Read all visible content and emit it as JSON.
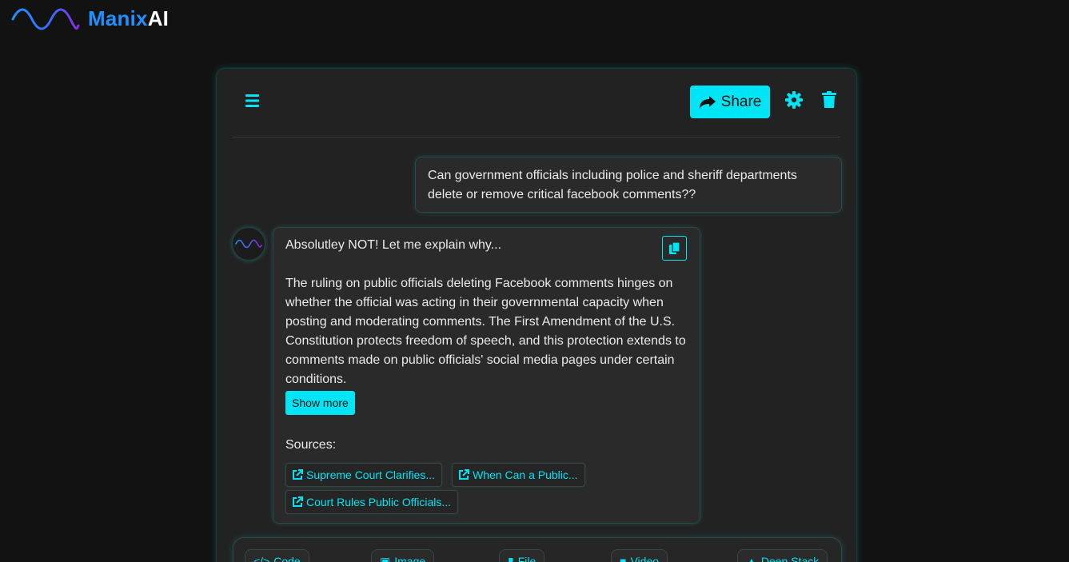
{
  "brand": {
    "name_part1": "Manix",
    "name_part2": "AI"
  },
  "toolbar": {
    "share_label": "Share"
  },
  "conversation": {
    "user_message": "Can government officials including police and sheriff departments delete or remove critical facebook comments??",
    "bot_intro": "Absolutley NOT! Let me explain why...",
    "bot_body": "The ruling on public officials deleting Facebook comments hinges on whether the official was acting in their governmental capacity when posting and moderating comments. The First Amendment of the U.S. Constitution protects freedom of speech, and this protection extends to comments made on public officials' social media pages under certain conditions.",
    "show_more_label": "Show more",
    "sources_label": "Sources:",
    "sources": [
      {
        "label": "Supreme Court Clarifies..."
      },
      {
        "label": "When Can a Public..."
      },
      {
        "label": "Court Rules Public Officials..."
      }
    ]
  },
  "modes": [
    {
      "label": "Code",
      "icon": "code-icon"
    },
    {
      "label": "Image",
      "icon": "image-icon"
    },
    {
      "label": "File",
      "icon": "file-icon"
    },
    {
      "label": "Video",
      "icon": "video-icon"
    },
    {
      "label": "Deep Stack",
      "icon": "graduation-cap-icon"
    }
  ],
  "colors": {
    "accent": "#00e5f5",
    "brand_blue": "#1e90ff",
    "background": "#121212",
    "panel": "#222222"
  }
}
